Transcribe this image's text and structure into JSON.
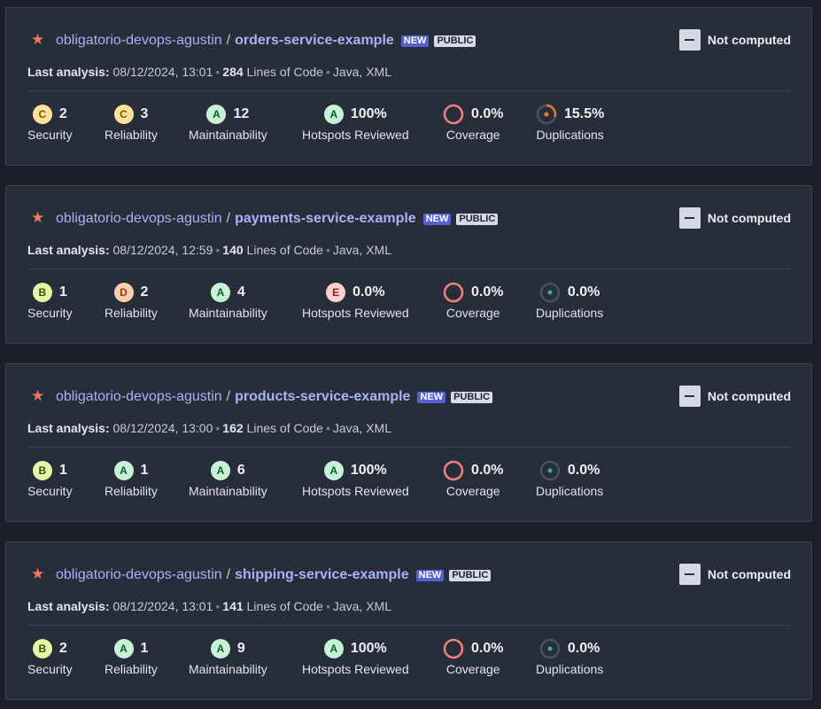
{
  "projects": [
    {
      "org": "obligatorio-devops-agustin",
      "separator": "/",
      "name": "orders-service-example",
      "badge_new": "NEW",
      "badge_public": "PUBLIC",
      "quality_gate": "Not computed",
      "analysis_label": "Last analysis:",
      "analysis_date": "08/12/2024, 13:01",
      "loc_value": "284",
      "loc_label": "Lines of Code",
      "languages": "Java, XML",
      "security": {
        "rating": "C",
        "value": "2",
        "label": "Security"
      },
      "reliability": {
        "rating": "C",
        "value": "3",
        "label": "Reliability"
      },
      "maintainability": {
        "rating": "A",
        "value": "12",
        "label": "Maintainability"
      },
      "hotspots": {
        "rating": "A",
        "value": "100%",
        "label": "Hotspots Reviewed"
      },
      "coverage": {
        "value": "0.0%",
        "label": "Coverage"
      },
      "duplications": {
        "value": "15.5%",
        "label": "Duplications"
      }
    },
    {
      "org": "obligatorio-devops-agustin",
      "separator": "/",
      "name": "payments-service-example",
      "badge_new": "NEW",
      "badge_public": "PUBLIC",
      "quality_gate": "Not computed",
      "analysis_label": "Last analysis:",
      "analysis_date": "08/12/2024, 12:59",
      "loc_value": "140",
      "loc_label": "Lines of Code",
      "languages": "Java, XML",
      "security": {
        "rating": "B",
        "value": "1",
        "label": "Security"
      },
      "reliability": {
        "rating": "D",
        "value": "2",
        "label": "Reliability"
      },
      "maintainability": {
        "rating": "A",
        "value": "4",
        "label": "Maintainability"
      },
      "hotspots": {
        "rating": "E",
        "value": "0.0%",
        "label": "Hotspots Reviewed"
      },
      "coverage": {
        "value": "0.0%",
        "label": "Coverage"
      },
      "duplications": {
        "value": "0.0%",
        "label": "Duplications"
      }
    },
    {
      "org": "obligatorio-devops-agustin",
      "separator": "/",
      "name": "products-service-example",
      "badge_new": "NEW",
      "badge_public": "PUBLIC",
      "quality_gate": "Not computed",
      "analysis_label": "Last analysis:",
      "analysis_date": "08/12/2024, 13:00",
      "loc_value": "162",
      "loc_label": "Lines of Code",
      "languages": "Java, XML",
      "security": {
        "rating": "B",
        "value": "1",
        "label": "Security"
      },
      "reliability": {
        "rating": "A",
        "value": "1",
        "label": "Reliability"
      },
      "maintainability": {
        "rating": "A",
        "value": "6",
        "label": "Maintainability"
      },
      "hotspots": {
        "rating": "A",
        "value": "100%",
        "label": "Hotspots Reviewed"
      },
      "coverage": {
        "value": "0.0%",
        "label": "Coverage"
      },
      "duplications": {
        "value": "0.0%",
        "label": "Duplications"
      }
    },
    {
      "org": "obligatorio-devops-agustin",
      "separator": "/",
      "name": "shipping-service-example",
      "badge_new": "NEW",
      "badge_public": "PUBLIC",
      "quality_gate": "Not computed",
      "analysis_label": "Last analysis:",
      "analysis_date": "08/12/2024, 13:01",
      "loc_value": "141",
      "loc_label": "Lines of Code",
      "languages": "Java, XML",
      "security": {
        "rating": "B",
        "value": "2",
        "label": "Security"
      },
      "reliability": {
        "rating": "A",
        "value": "1",
        "label": "Reliability"
      },
      "maintainability": {
        "rating": "A",
        "value": "9",
        "label": "Maintainability"
      },
      "hotspots": {
        "rating": "A",
        "value": "100%",
        "label": "Hotspots Reviewed"
      },
      "coverage": {
        "value": "0.0%",
        "label": "Coverage"
      },
      "duplications": {
        "value": "0.0%",
        "label": "Duplications"
      }
    }
  ],
  "colors": {
    "coverage_ring": "#f07f7f",
    "duplication_high": "#f0782c",
    "duplication_low": "#2dbb73",
    "link": "#a7b3f6",
    "star": "#f2785a"
  }
}
